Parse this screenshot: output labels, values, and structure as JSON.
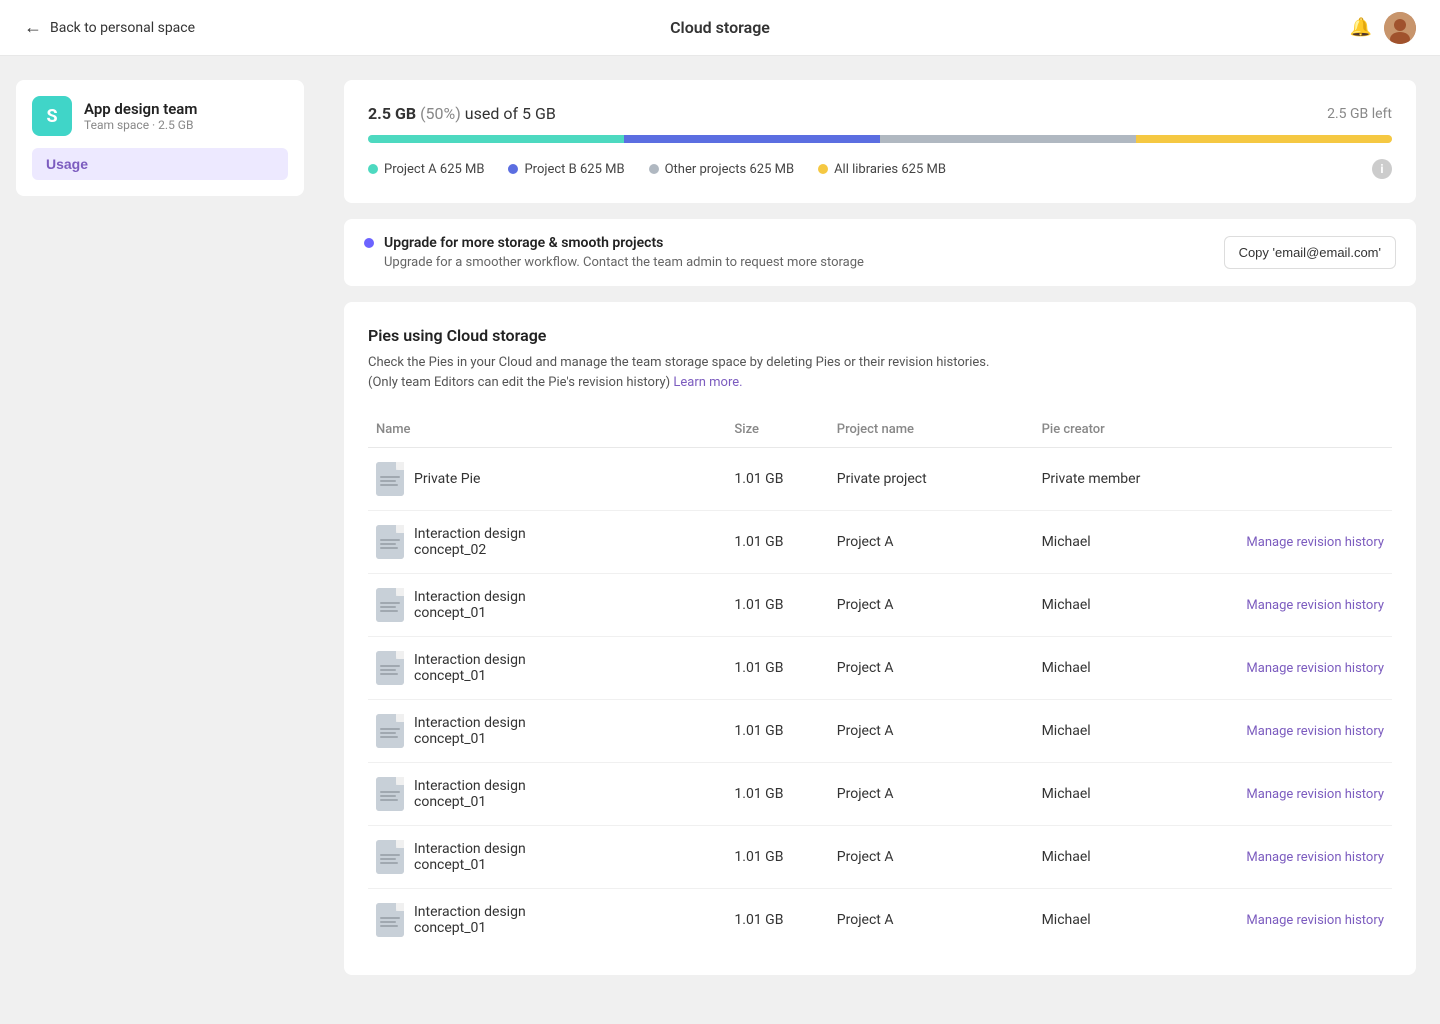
{
  "header": {
    "back_label": "Back to personal space",
    "title": "Cloud storage",
    "bell_icon": "bell-icon",
    "avatar_icon": "user-avatar"
  },
  "sidebar": {
    "team_icon_letter": "S",
    "team_name": "App design team",
    "team_meta": "Team space · 2.5 GB",
    "usage_label": "Usage"
  },
  "storage": {
    "used_gb": "2.5 GB",
    "percentage": "(50%)",
    "total": "5 GB",
    "left": "2.5 GB left",
    "segments": [
      {
        "color": "#4dd9c0",
        "width": "25%"
      },
      {
        "color": "#5b6ee1",
        "width": "25%"
      },
      {
        "color": "#b0b8c1",
        "width": "25%"
      },
      {
        "color": "#f5c842",
        "width": "25%"
      }
    ],
    "legend": [
      {
        "color": "#4dd9c0",
        "label": "Project A",
        "size": "625 MB"
      },
      {
        "color": "#5b6ee1",
        "label": "Project B",
        "size": "625 MB"
      },
      {
        "color": "#b0b8c1",
        "label": "Other projects",
        "size": "625 MB"
      },
      {
        "color": "#f5c842",
        "label": "All libraries",
        "size": "625 MB"
      }
    ]
  },
  "upgrade": {
    "title": "Upgrade for more storage & smooth projects",
    "description": "Upgrade for a smoother workflow. Contact the team admin to request more storage",
    "copy_button_label": "Copy 'email@email.com'"
  },
  "pies_section": {
    "title": "Pies using Cloud storage",
    "description_part1": "Check the Pies in your Cloud and manage the team storage space by deleting Pies or their revision histories.\n(Only team Editors can edit the Pie's revision history)",
    "learn_more_label": "Learn more.",
    "table_headers": {
      "name": "Name",
      "size": "Size",
      "project": "Project name",
      "creator": "Pie creator"
    },
    "rows": [
      {
        "name": "Private Pie",
        "size": "1.01 GB",
        "project": "Private project",
        "creator": "Private member",
        "manage_link": null
      },
      {
        "name": "Interaction design\nconcept_02",
        "size": "1.01 GB",
        "project": "Project A",
        "creator": "Michael",
        "manage_link": "Manage revision history"
      },
      {
        "name": "Interaction design\nconcept_01",
        "size": "1.01 GB",
        "project": "Project A",
        "creator": "Michael",
        "manage_link": "Manage revision history"
      },
      {
        "name": "Interaction design\nconcept_01",
        "size": "1.01 GB",
        "project": "Project A",
        "creator": "Michael",
        "manage_link": "Manage revision history"
      },
      {
        "name": "Interaction design\nconcept_01",
        "size": "1.01 GB",
        "project": "Project A",
        "creator": "Michael",
        "manage_link": "Manage revision history"
      },
      {
        "name": "Interaction design\nconcept_01",
        "size": "1.01 GB",
        "project": "Project A",
        "creator": "Michael",
        "manage_link": "Manage revision history"
      },
      {
        "name": "Interaction design\nconcept_01",
        "size": "1.01 GB",
        "project": "Project A",
        "creator": "Michael",
        "manage_link": "Manage revision history"
      },
      {
        "name": "Interaction design\nconcept_01",
        "size": "1.01 GB",
        "project": "Project A",
        "creator": "Michael",
        "manage_link": "Manage revision history"
      }
    ]
  }
}
